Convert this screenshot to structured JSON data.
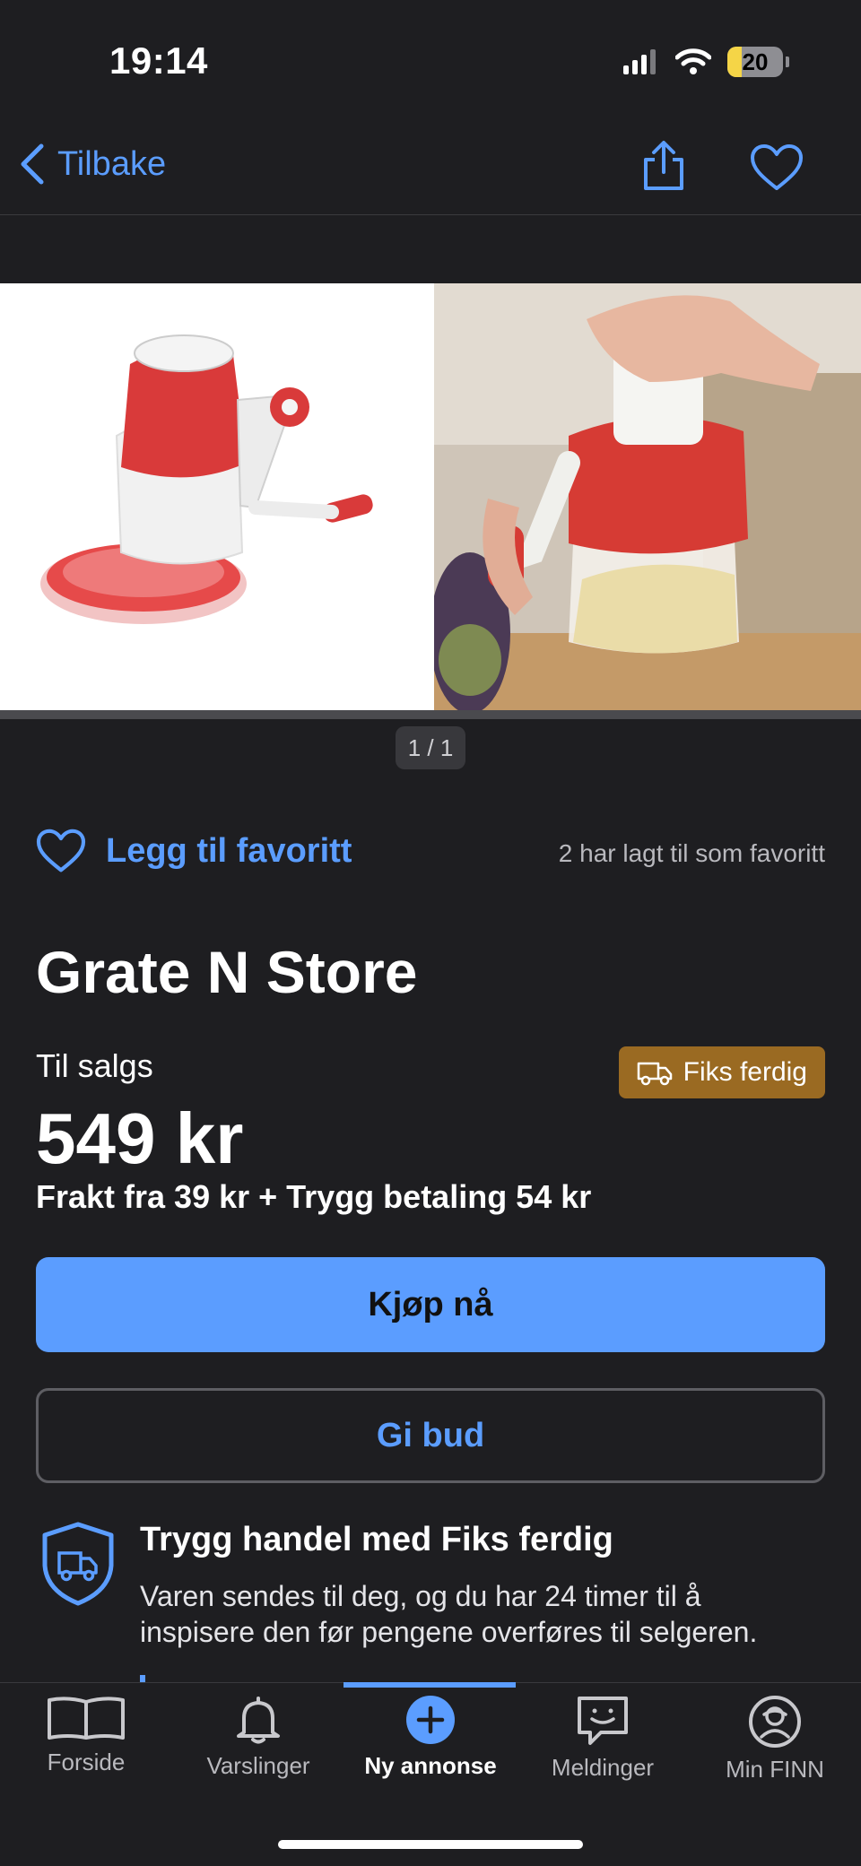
{
  "status_bar": {
    "time": "19:14",
    "battery_level": "20"
  },
  "nav": {
    "back_label": "Tilbake"
  },
  "gallery": {
    "counter": "1 / 1"
  },
  "favorite": {
    "label": "Legg til favoritt",
    "count_text": "2 har lagt til som favoritt"
  },
  "listing": {
    "title": "Grate N Store",
    "status": "Til salgs",
    "badge": "Fiks ferdig",
    "price": "549 kr",
    "shipping": "Frakt fra 39 kr + Trygg betaling 54 kr"
  },
  "actions": {
    "buy_label": "Kjøp nå",
    "bid_label": "Gi bud"
  },
  "safe_trade": {
    "title": "Trygg handel med Fiks ferdig",
    "text": "Varen sendes til deg, og du har 24 timer til å inspisere den før pengene overføres til selgeren."
  },
  "tabs": [
    {
      "label": "Forside",
      "icon": "book-icon"
    },
    {
      "label": "Varslinger",
      "icon": "bell-icon"
    },
    {
      "label": "Ny annonse",
      "icon": "plus-circle-icon",
      "active": true
    },
    {
      "label": "Meldinger",
      "icon": "chat-icon"
    },
    {
      "label": "Min FINN",
      "icon": "profile-icon"
    }
  ],
  "colors": {
    "accent": "#5b9dff",
    "background": "#1e1e21",
    "badge": "#9a6a22"
  }
}
